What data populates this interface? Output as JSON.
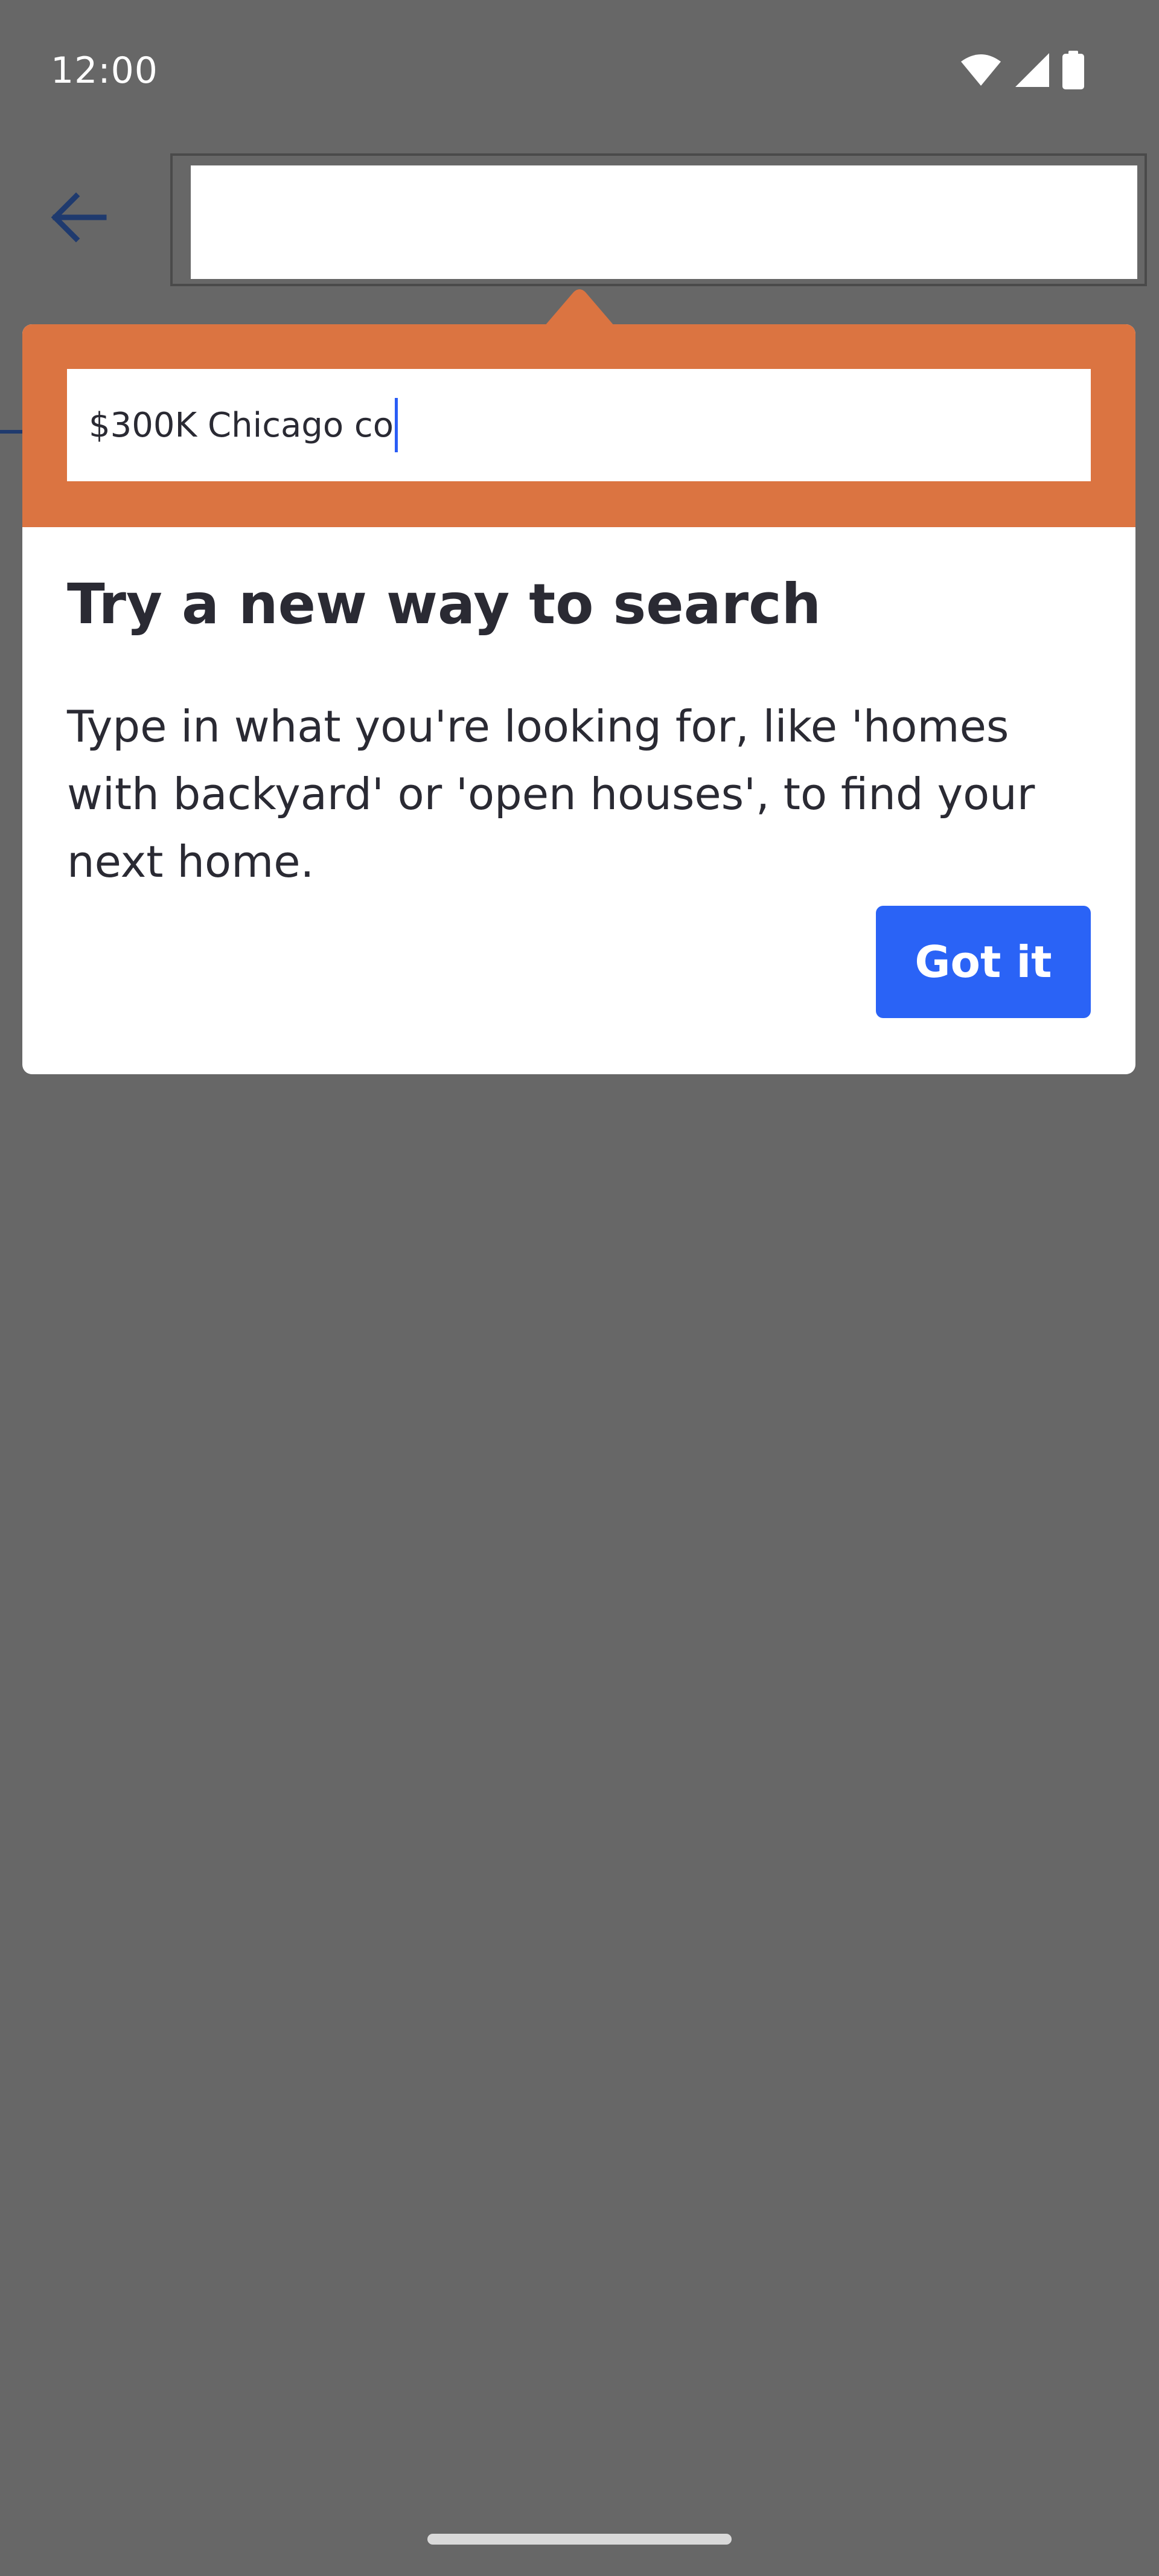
{
  "status_bar": {
    "time": "12:00",
    "icons": [
      "wifi-icon",
      "cellular-signal-icon",
      "battery-icon"
    ]
  },
  "app_bar": {
    "back_icon": "arrow-left-icon",
    "search_value": ""
  },
  "tooltip": {
    "search_value": "$300K Chicago co",
    "title": "Try a new way to search",
    "body": "Type in what you're looking for, like 'homes with backyard' or 'open houses', to find your next home.",
    "button_label": "Got it"
  },
  "colors": {
    "scrim": "#676767",
    "tooltip_header": "#db7441",
    "button": "#2a63f6",
    "text": "#2a2a33",
    "back_arrow": "#1f3a6e"
  }
}
